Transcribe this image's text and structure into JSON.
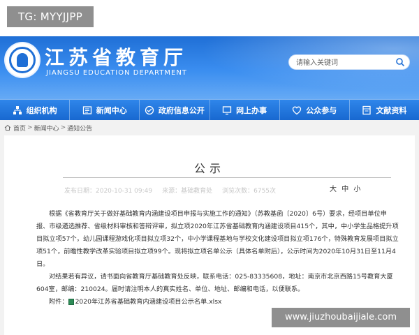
{
  "watermark_top": "TG: MYYJJPP",
  "header": {
    "title": "江苏省教育厅",
    "subtitle": "JIANGSU EDUCATION DEPARTMENT",
    "search_placeholder": "请输入关键词"
  },
  "nav": [
    {
      "label": "组织机构",
      "icon": "org-icon"
    },
    {
      "label": "新闻中心",
      "icon": "news-icon"
    },
    {
      "label": "政府信息公开",
      "icon": "info-disclosure-icon"
    },
    {
      "label": "网上办事",
      "icon": "online-service-icon"
    },
    {
      "label": "公众参与",
      "icon": "public-participation-icon"
    },
    {
      "label": "文献资料",
      "icon": "documents-icon"
    }
  ],
  "breadcrumb": [
    "首页",
    "新闻中心",
    "通知公告"
  ],
  "article": {
    "title": "公示",
    "meta": {
      "date": "发布日期：2020-10-31 09:49",
      "source": "来源：基础教育处",
      "views": "浏览次数：6755次"
    },
    "font_size": {
      "large": "大",
      "medium": "中",
      "small": "小"
    },
    "paragraphs": [
      "根据《省教育厅关于做好基础教育内涵建设项目申报与实施工作的通知》（苏教基函〔2020〕6号）要求，经项目单位申报、市级遴选推荐、省级材料审核和答辩评审，拟立项2020年江苏省基础教育内涵建设项目415个，其中，中小学生品格提升项目拟立项57个，幼儿园课程游戏化项目拟立项32个，中小学课程基地与学校文化建设项目拟立项176个，特殊教育发展项目拟立项51个，前瞻性教学改革实验项目拟立项99个。现将拟立项名单公示（具体名单附后），公示时间为2020年10月31日至11月4日。",
      "对结果若有异议，请书面向省教育厅基础教育处反映，联系电话：025-83335608，地址：南京市北京西路15号教育大厦604室，邮编：210024。届时请注明本人的真实姓名、单位、地址、邮编和电话，以便联系。"
    ],
    "attachment_label": "附件：",
    "attachment_file": "2020年江苏省基础教育内涵建设项目公示名单.xlsx"
  },
  "watermark_bottom": "www.jiuzhoubaijiale.com",
  "colors": {
    "header_blue": "#1f6fd6",
    "nav_blue": "#1767cf"
  }
}
